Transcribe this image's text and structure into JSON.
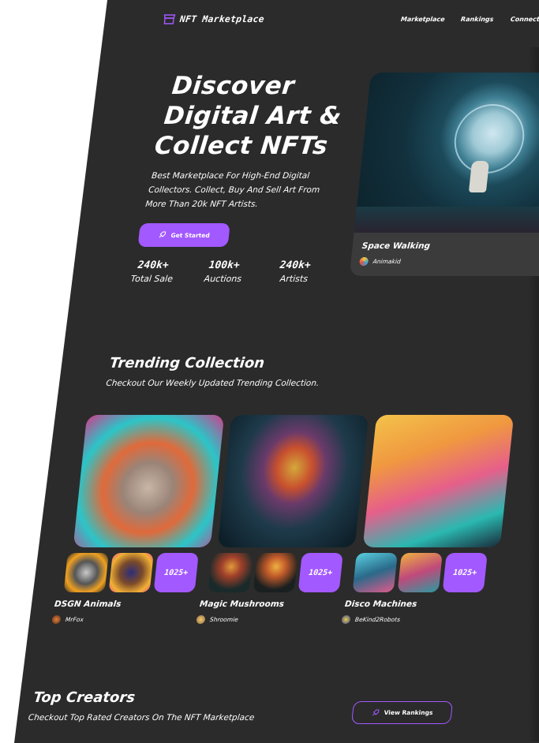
{
  "nav": {
    "logo_text": "NFT Marketplace",
    "links": [
      "Marketplace",
      "Rankings",
      "Connect a wallet"
    ]
  },
  "hero": {
    "title_lines": [
      "Discover",
      "Digital Art &",
      "Collect NFTs"
    ],
    "subtitle_lines": [
      "Best Marketplace For High-End Digital",
      "Collectors. Collect, Buy And Sell Art From",
      "More Than 20k NFT Artists."
    ],
    "cta_label": "Get Started",
    "stats": [
      {
        "value": "240k+",
        "label": "Total Sale"
      },
      {
        "value": "100k+",
        "label": "Auctions"
      },
      {
        "value": "240k+",
        "label": "Artists"
      }
    ],
    "featured": {
      "title": "Space Walking",
      "artist": "Animakid"
    }
  },
  "trending": {
    "title": "Trending Collection",
    "subtitle": "Checkout Our Weekly Updated Trending Collection.",
    "collections": [
      {
        "name": "DSGN Animals",
        "artist": "MrFox",
        "count": "1025+"
      },
      {
        "name": "Magic Mushrooms",
        "artist": "Shroomie",
        "count": "1025+"
      },
      {
        "name": "Disco Machines",
        "artist": "BeKind2Robots",
        "count": "1025+"
      }
    ]
  },
  "creators": {
    "title": "Top Creators",
    "subtitle": "Checkout Top Rated Creators On The NFT Marketplace",
    "button_label": "View Rankings"
  },
  "icons": {
    "logo": "storefront-icon",
    "rocket": "rocket-launch-icon"
  },
  "colors": {
    "accent": "#a259ff",
    "background": "#2b2b2b",
    "card": "#3b3b3b"
  }
}
